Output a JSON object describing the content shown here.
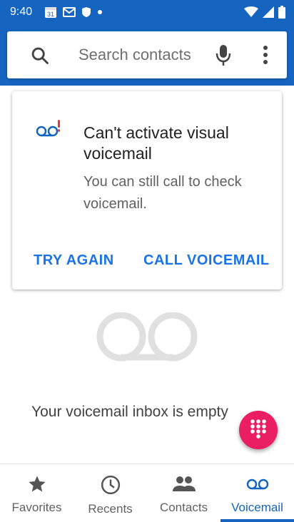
{
  "status_bar": {
    "time": "9:40",
    "calendar_day": "31"
  },
  "search": {
    "placeholder": "Search contacts"
  },
  "voicemail_card": {
    "title": "Can't activate visual voicemail",
    "description": "You can still call to check voicemail.",
    "try_again_label": "TRY AGAIN",
    "call_voicemail_label": "CALL VOICEMAIL"
  },
  "empty_state": {
    "message": "Your voicemail inbox is empty"
  },
  "bottom_nav": {
    "items": [
      {
        "label": "Favorites",
        "icon": "star-icon",
        "active": false
      },
      {
        "label": "Recents",
        "icon": "clock-icon",
        "active": false
      },
      {
        "label": "Contacts",
        "icon": "people-icon",
        "active": false
      },
      {
        "label": "Voicemail",
        "icon": "voicemail-icon",
        "active": true
      }
    ]
  },
  "colors": {
    "primary": "#1565c0",
    "accent_button": "#1a73e8",
    "fab": "#e91e63",
    "voicemail_alert": "#e53935"
  }
}
